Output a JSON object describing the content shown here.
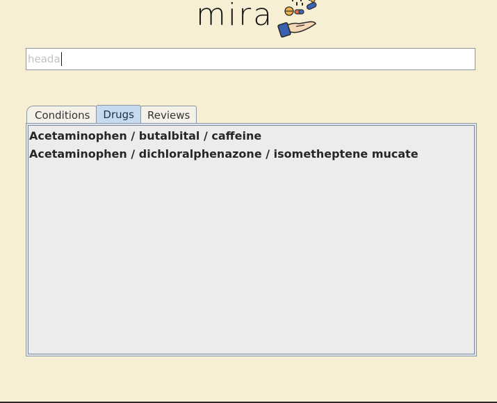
{
  "app": {
    "logo_text": "mira",
    "logo_icon": "pills-hand-icon"
  },
  "search": {
    "value": "heada",
    "placeholder": ""
  },
  "tabs": [
    {
      "label": "Conditions",
      "active": false
    },
    {
      "label": "Drugs",
      "active": true
    },
    {
      "label": "Reviews",
      "active": false
    }
  ],
  "results": [
    "Acetaminophen / butalbital / caffeine",
    "Acetaminophen / dichloralphenazone / isometheptene mucate"
  ],
  "colors": {
    "background": "#f6efd3",
    "active_tab": "#c8daf0",
    "panel": "#ececec"
  }
}
